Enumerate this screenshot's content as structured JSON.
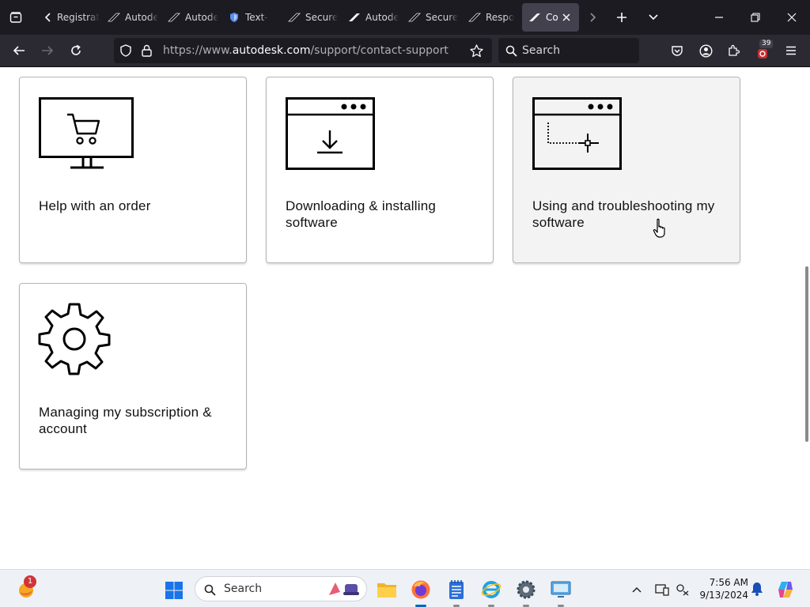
{
  "browser": {
    "tabs": [
      {
        "title": "Registration"
      },
      {
        "title": "Autodesk"
      },
      {
        "title": "Autodesk"
      },
      {
        "title": "Text-"
      },
      {
        "title": "Secure"
      },
      {
        "title": "Autodesk"
      },
      {
        "title": "Secure"
      },
      {
        "title": "Respo"
      },
      {
        "title": "Co",
        "active": true
      }
    ],
    "url_prefix": "https://www.",
    "url_host": "autodesk.com",
    "url_path": "/support/contact-support",
    "search_placeholder": "Search",
    "extension_badge": "39"
  },
  "cards": [
    {
      "label": "Help with an order",
      "icon": "shopping-cart-monitor-icon"
    },
    {
      "label": "Downloading & installing software",
      "icon": "download-window-icon"
    },
    {
      "label": "Using and troubleshooting my software",
      "icon": "software-window-icon"
    },
    {
      "label": "Managing my subscription & account",
      "icon": "gear-icon"
    }
  ],
  "taskbar": {
    "search_placeholder": "Search",
    "time": "7:56 AM",
    "date": "9/13/2024",
    "notification_count": "1"
  }
}
